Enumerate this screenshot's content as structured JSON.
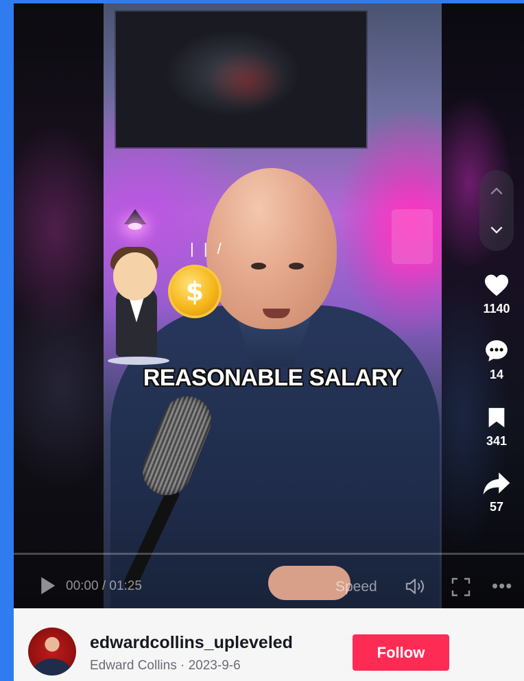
{
  "video": {
    "overlay_caption": "REASONABLE SALARY",
    "coin_symbol": "$"
  },
  "actions": {
    "likes": "1140",
    "comments": "14",
    "saves": "341",
    "shares": "57"
  },
  "player": {
    "time": "00:00 / 01:25",
    "speed_label": "Speed",
    "more_label": "•••",
    "progress": 0
  },
  "author": {
    "username": "edwardcollins_upleveled",
    "subtitle": "Edward Collins · 2023-9-6",
    "follow_label": "Follow"
  },
  "colors": {
    "follow_button": "#fe2c55",
    "page_background": "#2f7cf0"
  },
  "icons": [
    "chevron-up-icon",
    "chevron-down-icon",
    "heart-icon",
    "comment-icon",
    "bookmark-icon",
    "share-icon",
    "play-icon",
    "volume-icon",
    "fullscreen-icon",
    "more-icon"
  ]
}
